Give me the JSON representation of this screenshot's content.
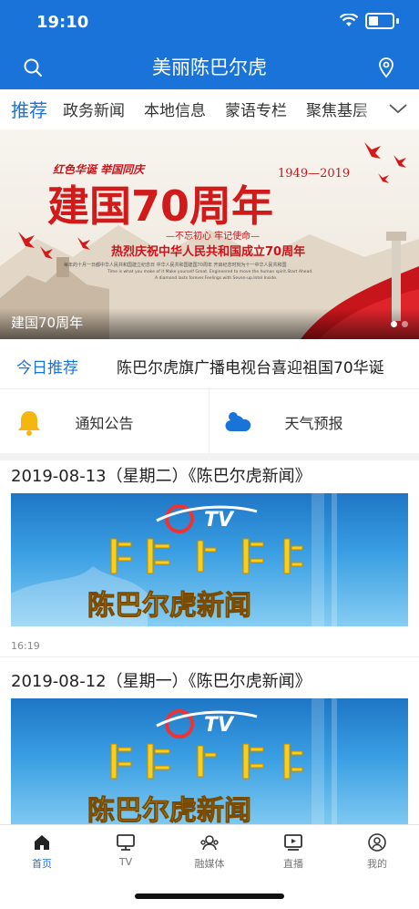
{
  "status": {
    "time": "19:10"
  },
  "header": {
    "title": "美丽陈巴尔虎"
  },
  "tabs": [
    {
      "label": "推荐",
      "active": true
    },
    {
      "label": "政务新闻"
    },
    {
      "label": "本地信息"
    },
    {
      "label": "蒙语专栏"
    },
    {
      "label": "聚焦基层"
    }
  ],
  "banner": {
    "caption": "建国70周年",
    "top_left_text": "红色华诞 举国同庆",
    "years": "1949—2019",
    "headline": "建国70周年",
    "slogan": "—不忘初心 牢记使命—",
    "subhead": "热烈庆祝中华人民共和国成立70周年",
    "fine_print_cn": "每年的十月一日都中华人民共和国建立纪念日 中华人民共和国建国70周年 开启纪念时刻为十一中华人民共和国",
    "fine_print_en_1": "Time is what you make of it Make yourself Great. Engineered to move the human spirit.Start Ahead.",
    "fine_print_en_2": "A diamond lasts forever.Feelings with Seven-up.Intel Inside.",
    "slide_count": 2,
    "active_slide": 0
  },
  "today": {
    "label": "今日推荐",
    "text": "陈巴尔虎旗广播电视台喜迎祖国70华诞"
  },
  "quick": [
    {
      "label": "通知公告",
      "icon": "bell-icon"
    },
    {
      "label": "天气预报",
      "icon": "weather-icon"
    }
  ],
  "news": [
    {
      "title": "2019-08-13（星期二）《陈巴尔虎新闻》",
      "thumb_text": "陈巴尔虎新闻",
      "logo": "TV",
      "time": "16:19"
    },
    {
      "title": "2019-08-12（星期一）《陈巴尔虎新闻》",
      "thumb_text": "陈巴尔虎新闻",
      "logo": "TV"
    }
  ],
  "nav": [
    {
      "label": "首页",
      "icon": "home-icon",
      "active": true
    },
    {
      "label": "TV",
      "icon": "tv-icon"
    },
    {
      "label": "融媒体",
      "icon": "media-icon"
    },
    {
      "label": "直播",
      "icon": "live-icon"
    },
    {
      "label": "我的",
      "icon": "user-icon"
    }
  ],
  "colors": {
    "primary": "#1a73d9",
    "accent_red": "#d11a1a",
    "gold": "#f5b70f"
  }
}
